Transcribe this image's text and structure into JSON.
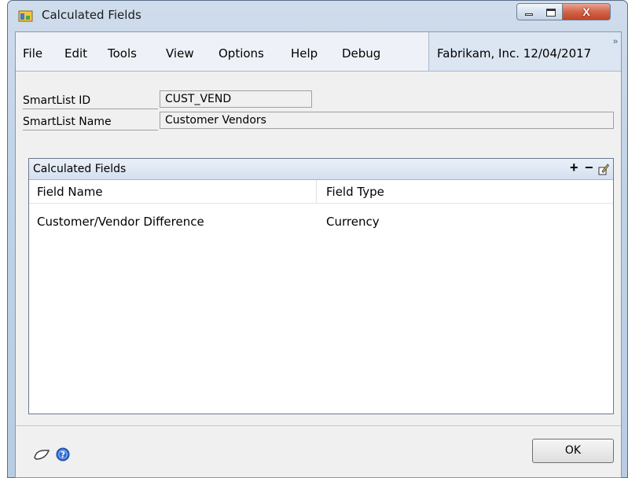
{
  "window": {
    "title": "Calculated Fields"
  },
  "menu": {
    "items": [
      "File",
      "Edit",
      "Tools",
      "View",
      "Options",
      "Help",
      "Debug"
    ],
    "company": "Fabrikam, Inc. 12/04/2017"
  },
  "form": {
    "smartlist_id_label": "SmartList ID",
    "smartlist_id_value": "CUST_VEND",
    "smartlist_name_label": "SmartList Name",
    "smartlist_name_value": "Customer Vendors"
  },
  "grid": {
    "title": "Calculated Fields",
    "columns": [
      "Field Name",
      "Field Type"
    ],
    "rows": [
      {
        "field_name": "Customer/Vendor Difference",
        "field_type": "Currency"
      }
    ],
    "icons": [
      "add-icon",
      "remove-icon",
      "edit-icon"
    ]
  },
  "footer": {
    "ok_label": "OK",
    "icons": [
      "note-icon",
      "help-icon"
    ]
  }
}
